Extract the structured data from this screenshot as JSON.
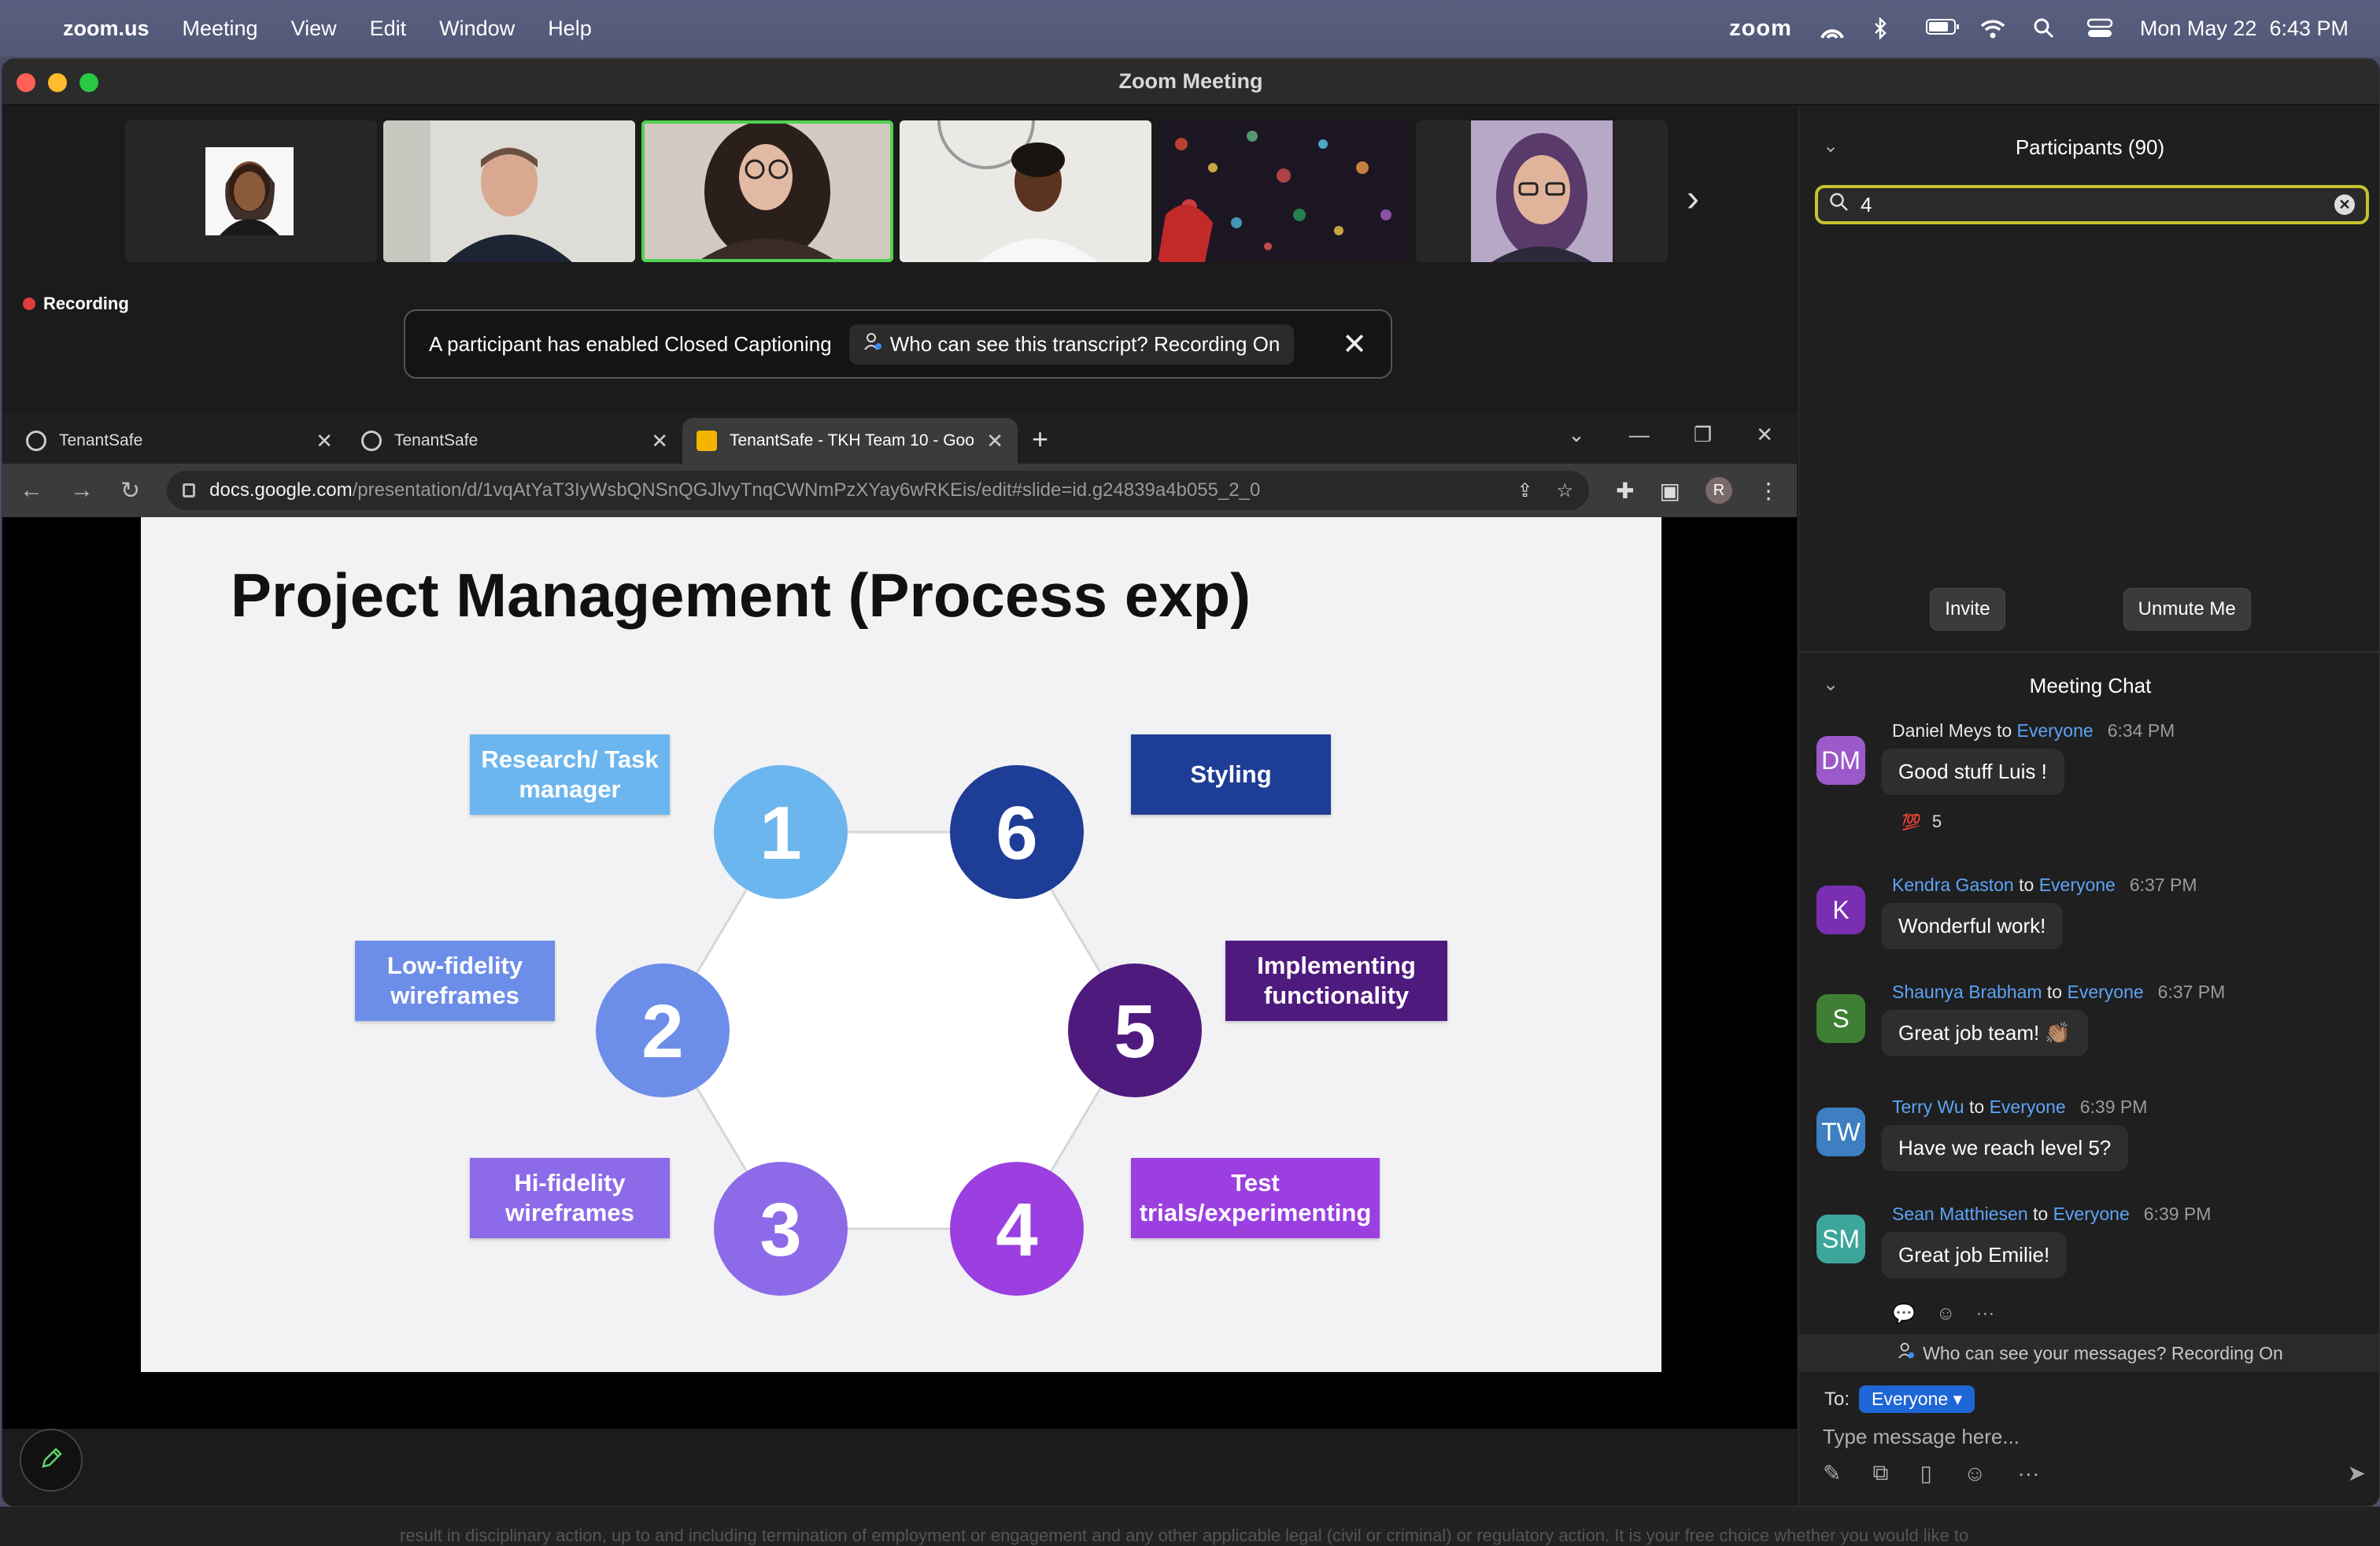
{
  "menubar": {
    "app": "zoom.us",
    "items": [
      "Meeting",
      "View",
      "Edit",
      "Window",
      "Help"
    ],
    "zoom_label": "zoom",
    "date": "Mon May 22",
    "time": "6:43 PM"
  },
  "window": {
    "title": "Zoom Meeting"
  },
  "recording_label": "Recording",
  "cc_banner": {
    "text": "A participant has enabled Closed Captioning",
    "pill": "Who can see this transcript? Recording On"
  },
  "browser": {
    "tabs": [
      {
        "label": "TenantSafe"
      },
      {
        "label": "TenantSafe"
      },
      {
        "label": "TenantSafe - TKH Team 10 - Goo"
      }
    ],
    "url_host": "docs.google.com",
    "url_path": "/presentation/d/1vqAtYaT3IyWsbQNSnQGJlvyTnqCWNmPzXYay6wRKEis/edit#slide=id.g24839a4b055_2_0",
    "profile_initial": "R"
  },
  "slide": {
    "title": "Project Management (Process exp)",
    "steps": [
      {
        "num": "1",
        "label": "Research/ Task manager",
        "color": "#6cb6ef"
      },
      {
        "num": "2",
        "label": "Low-fidelity wireframes",
        "color": "#6c8ee8"
      },
      {
        "num": "3",
        "label": "Hi-fidelity wireframes",
        "color": "#8c6ae8"
      },
      {
        "num": "4",
        "label": "Test trials/experimenting",
        "color": "#9b3fe0"
      },
      {
        "num": "5",
        "label": "Implementing functionality",
        "color": "#4f1a7e"
      },
      {
        "num": "6",
        "label": "Styling",
        "color": "#1e3d96"
      }
    ]
  },
  "participants": {
    "header": "Participants (90)",
    "search_value": "4",
    "invite_label": "Invite",
    "unmute_label": "Unmute Me"
  },
  "chat": {
    "header": "Meeting Chat",
    "to_label": "Everyone",
    "messages": [
      {
        "initials": "DM",
        "sender": "Daniel Meys",
        "to": "Everyone",
        "time": "6:34 PM",
        "text": "Good stuff Luis !",
        "color": "#9b59c9",
        "reaction_count": "5"
      },
      {
        "initials": "K",
        "sender": "Kendra Gaston",
        "to": "Everyone",
        "time": "6:37 PM",
        "text": "Wonderful work!",
        "color": "#7a2fb3"
      },
      {
        "initials": "S",
        "sender": "Shaunya Brabham",
        "to": "Everyone",
        "time": "6:37 PM",
        "text": "Great job team! 👏🏽",
        "color": "#3f7f33"
      },
      {
        "initials": "TW",
        "sender": "Terry Wu",
        "to": "Everyone",
        "time": "6:39 PM",
        "text": "Have we reach level 5?",
        "color": "#3d7fc0"
      },
      {
        "initials": "SM",
        "sender": "Sean Matthiesen",
        "to": "Everyone",
        "time": "6:39 PM",
        "text": "Great job Emilie!",
        "color": "#3ca69a"
      }
    ],
    "to_word": "to",
    "visibility_note": "Who can see your messages? Recording On",
    "to_prefix": "To:",
    "input_placeholder": "Type message here..."
  },
  "bottom_strip_text": "result in disciplinary action, up to and including termination of employment or engagement and any other applicable legal (civil or criminal) or regulatory action. It is your free choice whether you would like to"
}
